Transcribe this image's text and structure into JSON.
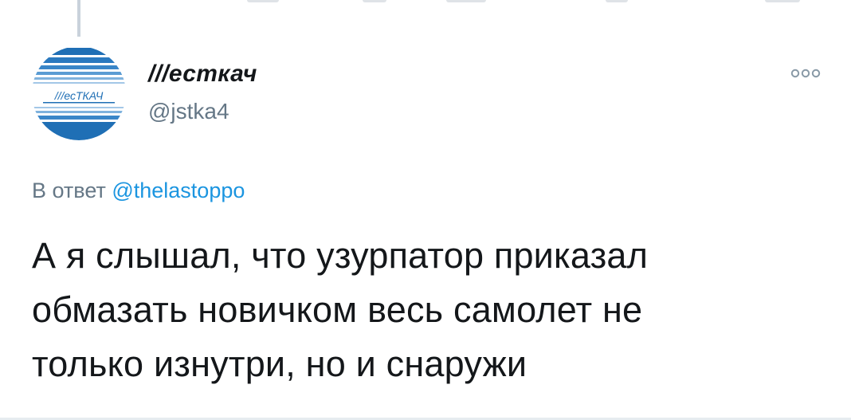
{
  "tweet": {
    "author": {
      "display_name": "///есткач",
      "handle": "@jstka4",
      "avatar_text": "///есТКАЧ",
      "avatar_icon": "logo-avatar"
    },
    "more_icon": "more-options-icon",
    "reply_prefix": "В ответ",
    "reply_mention": "@thelastoppo",
    "text_lines": [
      "А я слышал, что узурпатор приказал",
      "обмазать новичком весь самолет не",
      "только изнутри, но и снаружи"
    ]
  },
  "colors": {
    "text_primary": "#14171a",
    "text_secondary": "#657786",
    "link": "#1b95e0",
    "avatar_blue": "#1f6fb5"
  }
}
